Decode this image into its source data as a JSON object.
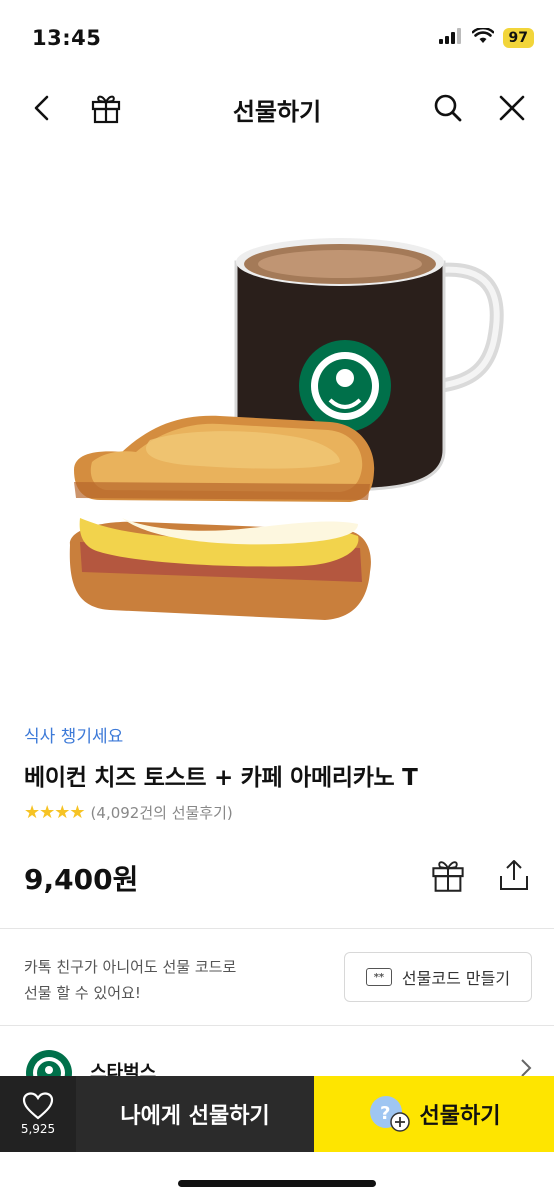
{
  "status_bar": {
    "time": "13:45",
    "battery": "97",
    "icons": [
      "signal-icon",
      "wifi-icon",
      "battery-icon"
    ]
  },
  "nav": {
    "title": "선물하기",
    "icons": [
      "back-icon",
      "gift-box-icon",
      "search-icon",
      "close-icon"
    ]
  },
  "product": {
    "image_alt": "bacon-cheese-toast-and-americano",
    "category": "식사 챙기세요",
    "title": "베이컨 치즈 토스트 + 카페 아메리카노 T",
    "stars": "★★★★",
    "rating_fraction": 0.8,
    "review_text": "(4,092건의 선물후기)",
    "price": "9,400원"
  },
  "gift_code": {
    "text_line1": "카톡 친구가 아니어도 선물 코드로",
    "text_line2": "선물 할 수 있어요!",
    "code_icon_text": "**",
    "button_label": "선물코드 만들기"
  },
  "brand": {
    "name": "스타벅스"
  },
  "bottom_bar": {
    "like_count": "5,925",
    "gift_self_label": "나에게 선물하기",
    "gift_label": "선물하기"
  },
  "colors": {
    "accent_yellow": "#fee500",
    "link_blue": "#3d7ad8",
    "star_yellow": "#f6c324",
    "brand_green": "#00704a",
    "dark_button": "#2b2b2b"
  }
}
